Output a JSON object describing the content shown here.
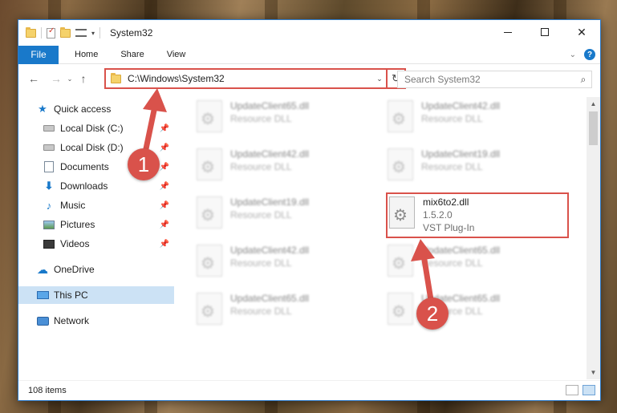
{
  "window": {
    "title": "System32",
    "controls": {
      "minimize": "minimize",
      "maximize": "maximize",
      "close": "✕"
    }
  },
  "ribbon": {
    "file": "File",
    "tabs": [
      "Home",
      "Share",
      "View"
    ],
    "help": "?"
  },
  "navigation": {
    "back": "←",
    "forward": "→",
    "recent": "⌄",
    "up": "↑",
    "address": "C:\\Windows\\System32",
    "refresh": "↻",
    "search_placeholder": "Search System32"
  },
  "sidebar": {
    "items": [
      {
        "label": "Quick access",
        "icon": "star-icon",
        "pinned": false
      },
      {
        "label": "Local Disk (C:)",
        "icon": "drive-icon",
        "pinned": true
      },
      {
        "label": "Local Disk (D:)",
        "icon": "drive-icon",
        "pinned": true
      },
      {
        "label": "Documents",
        "icon": "documents-icon",
        "pinned": true
      },
      {
        "label": "Downloads",
        "icon": "downloads-icon",
        "pinned": true
      },
      {
        "label": "Music",
        "icon": "music-icon",
        "pinned": true
      },
      {
        "label": "Pictures",
        "icon": "pictures-icon",
        "pinned": true
      },
      {
        "label": "Videos",
        "icon": "videos-icon",
        "pinned": true
      },
      {
        "label": "OneDrive",
        "icon": "onedrive-icon",
        "pinned": false
      },
      {
        "label": "This PC",
        "icon": "pc-icon",
        "pinned": false,
        "selected": true
      },
      {
        "label": "Network",
        "icon": "network-icon",
        "pinned": false
      }
    ]
  },
  "files": [
    {
      "name": "UpdateClient65.dll",
      "type": "Resource DLL"
    },
    {
      "name": "UpdateClient42.dll",
      "type": "Resource DLL"
    },
    {
      "name": "UpdateClient42.dll",
      "type": "Resource DLL"
    },
    {
      "name": "UpdateClient19.dll",
      "type": "Resource DLL"
    },
    {
      "name": "UpdateClient19.dll",
      "type": "Resource DLL"
    },
    {
      "name": "mix6to2.dll",
      "version": "1.5.2.0",
      "type": "VST Plug-In",
      "highlighted": true
    },
    {
      "name": "UpdateClient42.dll",
      "type": "Resource DLL"
    },
    {
      "name": "UpdateClient65.dll",
      "type": "Resource DLL"
    },
    {
      "name": "UpdateClient65.dll",
      "type": "Resource DLL"
    },
    {
      "name": "UpdateClient65.dll",
      "type": "Resource DLL"
    }
  ],
  "status": {
    "item_count": "108 items"
  },
  "annotations": {
    "step1": "1",
    "step2": "2",
    "color": "#d9524b"
  }
}
